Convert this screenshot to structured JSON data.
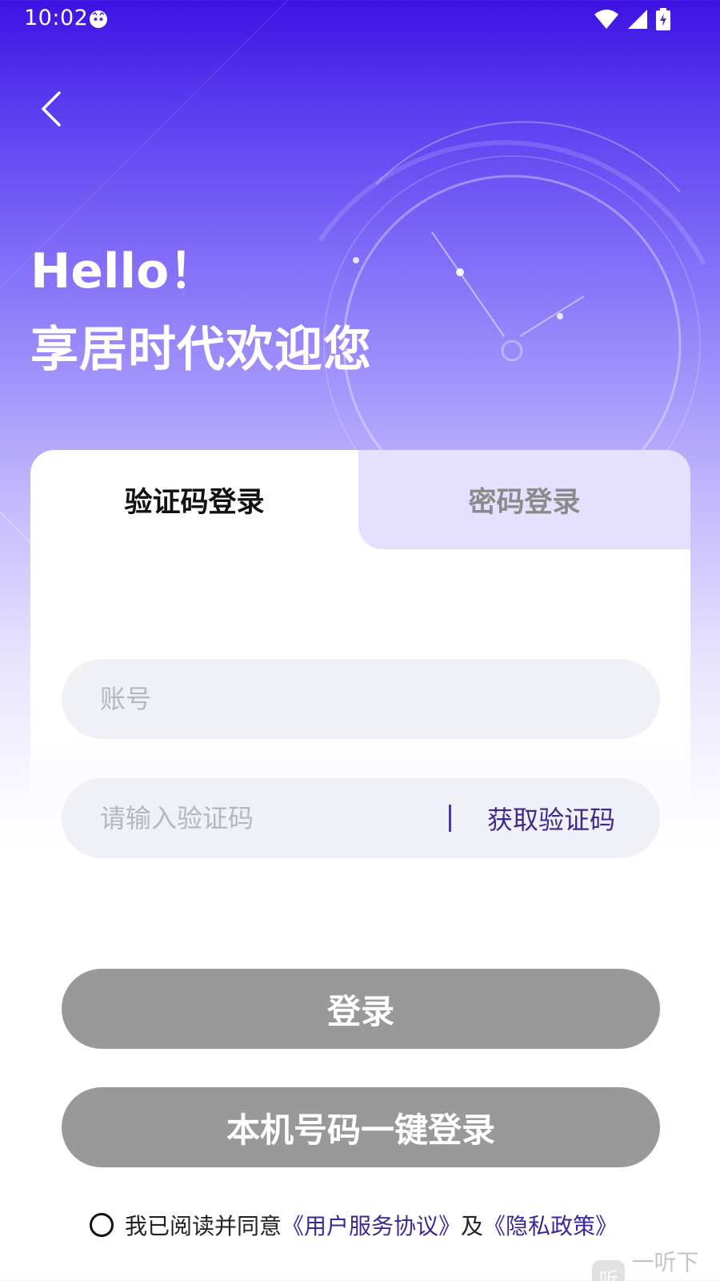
{
  "status_bar": {
    "time": "10:02"
  },
  "header": {
    "hello": "Hello！",
    "welcome": "享居时代欢迎您"
  },
  "tabs": [
    {
      "label": "验证码登录",
      "active": true
    },
    {
      "label": "密码登录",
      "active": false
    }
  ],
  "form": {
    "account_placeholder": "账号",
    "code_placeholder": "请输入验证码",
    "get_code_label": "获取验证码"
  },
  "buttons": {
    "login": "登录",
    "one_click_login": "本机号码一键登录"
  },
  "agreement": {
    "prefix": "我已阅读并同意",
    "user_agreement": "《用户服务协议》",
    "and": "及",
    "privacy_policy": "《隐私政策》",
    "checked": false
  },
  "watermark": {
    "logo_char": "听",
    "text": "一听下载"
  },
  "colors": {
    "primary": "#4a2fc8",
    "button_disabled": "#999999",
    "link": "#3b2a96",
    "input_bg": "#f0f1f6"
  }
}
